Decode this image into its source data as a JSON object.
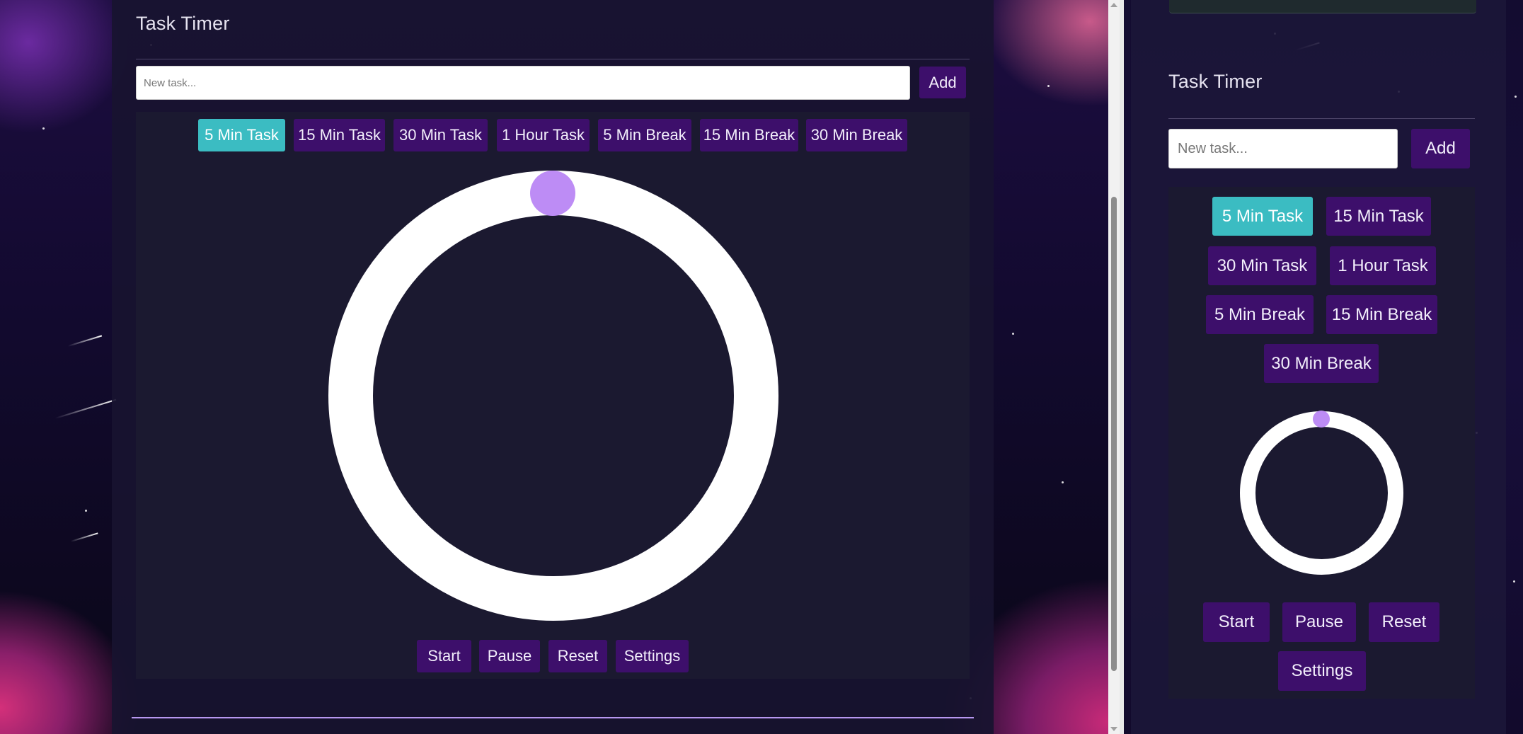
{
  "left_view": {
    "title": "Task Timer",
    "input": {
      "placeholder": "New task..."
    },
    "add_button": "Add",
    "presets": [
      {
        "label": "5 Min Task",
        "active": true
      },
      {
        "label": "15 Min Task",
        "active": false
      },
      {
        "label": "30 Min Task",
        "active": false
      },
      {
        "label": "1 Hour Task",
        "active": false
      },
      {
        "label": "5 Min Break",
        "active": false
      },
      {
        "label": "15 Min Break",
        "active": false
      },
      {
        "label": "30 Min Break",
        "active": false
      }
    ],
    "controls": [
      "Start",
      "Pause",
      "Reset",
      "Settings"
    ]
  },
  "right_view": {
    "title": "Task Timer",
    "input": {
      "placeholder": "New task..."
    },
    "add_button": "Add",
    "presets": [
      {
        "label": "5 Min Task",
        "active": true
      },
      {
        "label": "15 Min Task",
        "active": false
      },
      {
        "label": "30 Min Task",
        "active": false
      },
      {
        "label": "1 Hour Task",
        "active": false
      },
      {
        "label": "5 Min Break",
        "active": false
      },
      {
        "label": "15 Min Break",
        "active": false
      },
      {
        "label": "30 Min Break",
        "active": false
      }
    ],
    "controls": [
      "Start",
      "Pause",
      "Reset",
      "Settings"
    ]
  },
  "colors": {
    "button_bg": "#3d0f6b",
    "active_button_bg": "#3bbcc2",
    "ring": "#ffffff",
    "knob": "#bd8cf5"
  }
}
